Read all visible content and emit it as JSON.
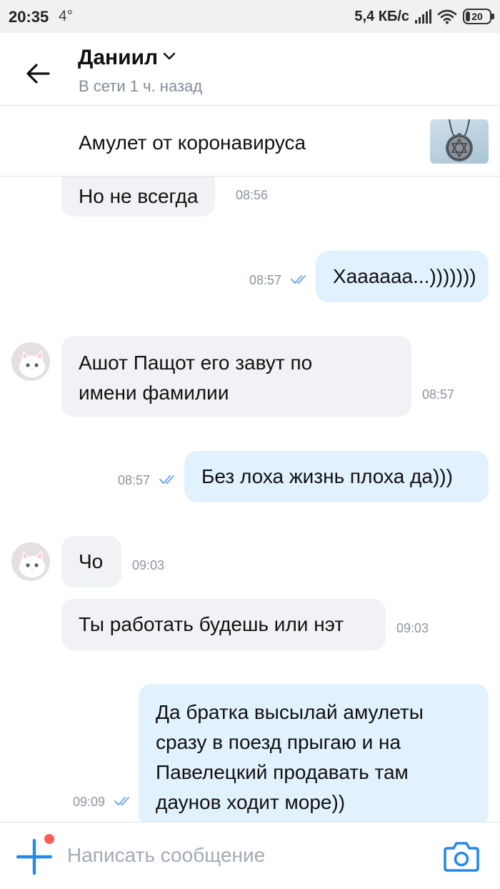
{
  "status_bar": {
    "time": "20:35",
    "temperature": "4°",
    "net_speed": "5,4 КБ/с",
    "battery_level": "20",
    "battery_fraction": 0.2
  },
  "header": {
    "contact_name": "Даниил",
    "last_seen": "В сети 1 ч. назад",
    "back_icon": "arrow-left-icon",
    "dropdown_icon": "chevron-down-icon"
  },
  "pinned": {
    "text": "Амулет от коронавируса",
    "thumbnail": "amulet-photo"
  },
  "messages": [
    {
      "direction": "in",
      "text": "Но не всегда",
      "time": "08:56"
    },
    {
      "direction": "out",
      "text": "Хаааааа...)))))))",
      "time": "08:57",
      "read": true
    },
    {
      "direction": "in",
      "lines": [
        "Ашот Пащот его завут по",
        "имени фамилии"
      ],
      "time": "08:57"
    },
    {
      "direction": "out",
      "text": "Без лоха жизнь плоха да)))",
      "time": "08:57",
      "read": true
    },
    {
      "direction": "in",
      "text": "Чо",
      "time": "09:03"
    },
    {
      "direction": "in",
      "text": "Ты работать будешь или нэт",
      "time": "09:03"
    },
    {
      "direction": "out",
      "lines": [
        "Да братка высылай амулеты",
        "сразу в поезд прыгаю и на",
        "Павелецкий продавать там",
        "даунов ходит море))"
      ],
      "time": "09:09",
      "read": true
    }
  ],
  "composer": {
    "placeholder": "Написать сообщение",
    "add_icon": "plus-icon",
    "camera_icon": "camera-icon"
  },
  "colors": {
    "accent": "#2688eb",
    "incoming_bubble": "#f0f2f5",
    "outgoing_bubble": "#e1f1fd",
    "read_check": "#71aaeb",
    "notification_dot": "#ff5c5c"
  }
}
